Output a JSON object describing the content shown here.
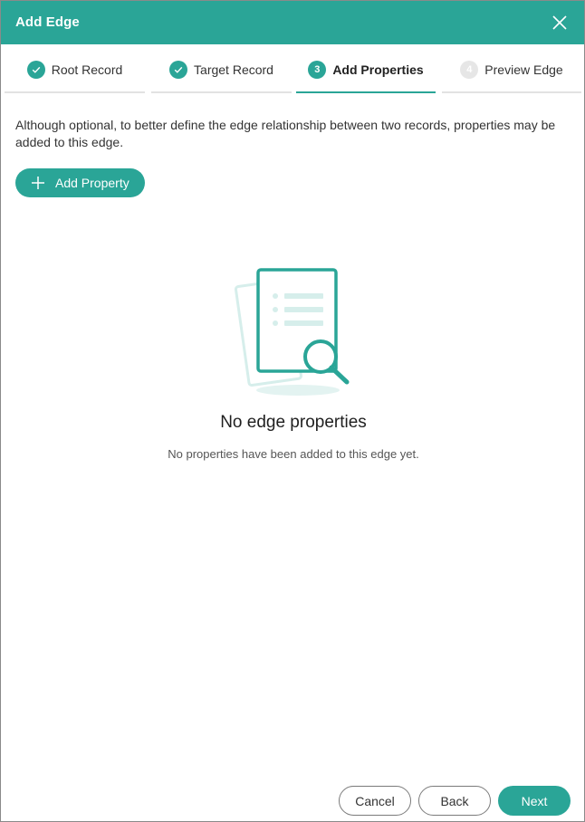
{
  "dialog": {
    "title": "Add Edge",
    "close_icon": "close-icon"
  },
  "steps": [
    {
      "label": "Root Record",
      "state": "done",
      "marker": ""
    },
    {
      "label": "Target Record",
      "state": "done",
      "marker": ""
    },
    {
      "label": "Add Properties",
      "state": "active",
      "marker": "3"
    },
    {
      "label": "Preview Edge",
      "state": "pending",
      "marker": "4"
    }
  ],
  "content": {
    "description": "Although optional, to better define the edge relationship between two records, properties may be added to this edge.",
    "add_property_label": "Add Property",
    "empty_title": "No edge properties",
    "empty_subtitle": "No properties have been added to this edge yet."
  },
  "footer": {
    "cancel_label": "Cancel",
    "back_label": "Back",
    "next_label": "Next"
  },
  "colors": {
    "accent": "#2aa597",
    "pending_step": "#e6e6e6"
  }
}
